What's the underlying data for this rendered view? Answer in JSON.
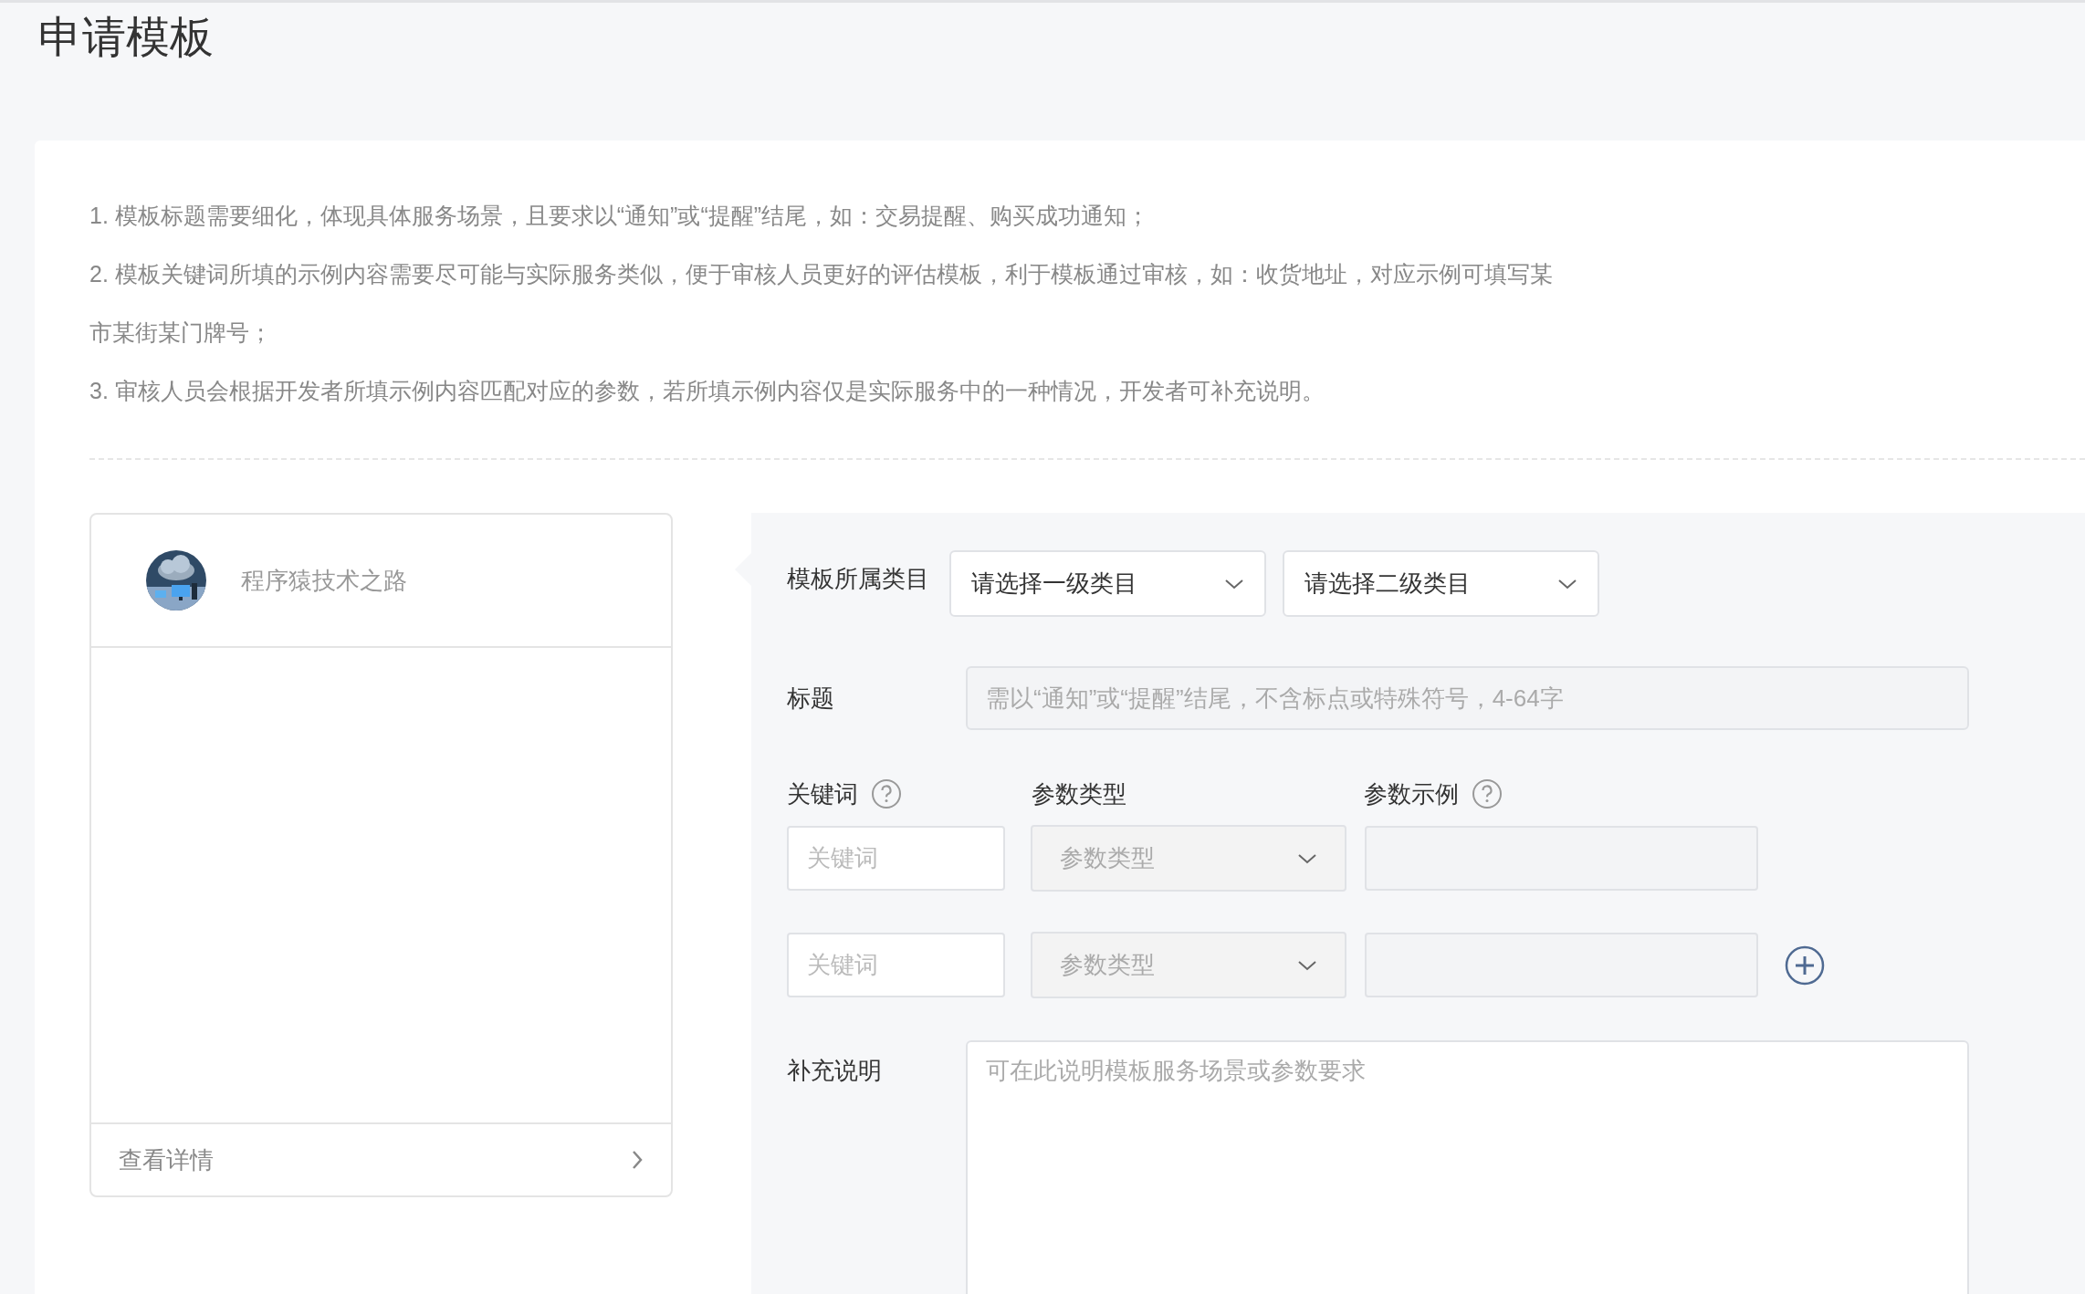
{
  "page_title": "申请模板",
  "notes": [
    "1. 模板标题需要细化，体现具体服务场景，且要求以“通知”或“提醒”结尾，如：交易提醒、购买成功通知；",
    "2. 模板关键词所填的示例内容需要尽可能与实际服务类似，便于审核人员更好的评估模板，利于模板通过审核，如：收货地址，对应示例可填写某",
    "市某街某门牌号；",
    "3. 审核人员会根据开发者所填示例内容匹配对应的参数，若所填示例内容仅是实际服务中的一种情况，开发者可补充说明。"
  ],
  "preview": {
    "account_name": "程序猿技术之路",
    "footer_link": "查看详情"
  },
  "form": {
    "category": {
      "label": "模板所属类目",
      "selects": [
        {
          "value": "请选择一级类目"
        },
        {
          "value": "请选择二级类目"
        }
      ]
    },
    "title": {
      "label": "标题",
      "placeholder": "需以“通知”或“提醒”结尾，不含标点或特殊符号，4-64字"
    },
    "columns": [
      {
        "label": "关键词",
        "help": true
      },
      {
        "label": "参数类型",
        "help": false
      },
      {
        "label": "参数示例",
        "help": true
      }
    ],
    "rows": [
      {
        "keyword_placeholder": "关键词",
        "type_placeholder": "参数类型",
        "type_disabled": true,
        "add_button": false
      },
      {
        "keyword_placeholder": "关键词",
        "type_placeholder": "参数类型",
        "type_disabled": true,
        "add_button": true
      }
    ],
    "remark": {
      "label": "补充说明",
      "placeholder": "可在此说明模板服务场景或参数要求"
    }
  }
}
